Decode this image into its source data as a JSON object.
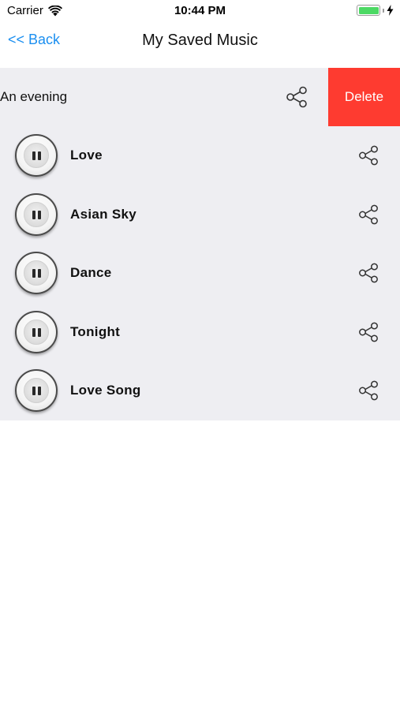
{
  "status_bar": {
    "carrier": "Carrier",
    "time": "10:44 PM",
    "battery_color": "#4cd964"
  },
  "nav": {
    "back_label": "<< Back",
    "title": "My Saved Music",
    "accent_color": "#1b8ff0"
  },
  "album": {
    "title": "An evening",
    "share_icon": "share-icon",
    "delete_label": "Delete",
    "delete_color": "#fe3b30"
  },
  "tracks": [
    {
      "title": "Love",
      "state_icon": "pause-icon"
    },
    {
      "title": "Asian Sky",
      "state_icon": "pause-icon"
    },
    {
      "title": "Dance",
      "state_icon": "pause-icon"
    },
    {
      "title": "Tonight",
      "state_icon": "pause-icon"
    },
    {
      "title": "Love Song",
      "state_icon": "pause-icon"
    }
  ],
  "list_background": "#eeeef2"
}
